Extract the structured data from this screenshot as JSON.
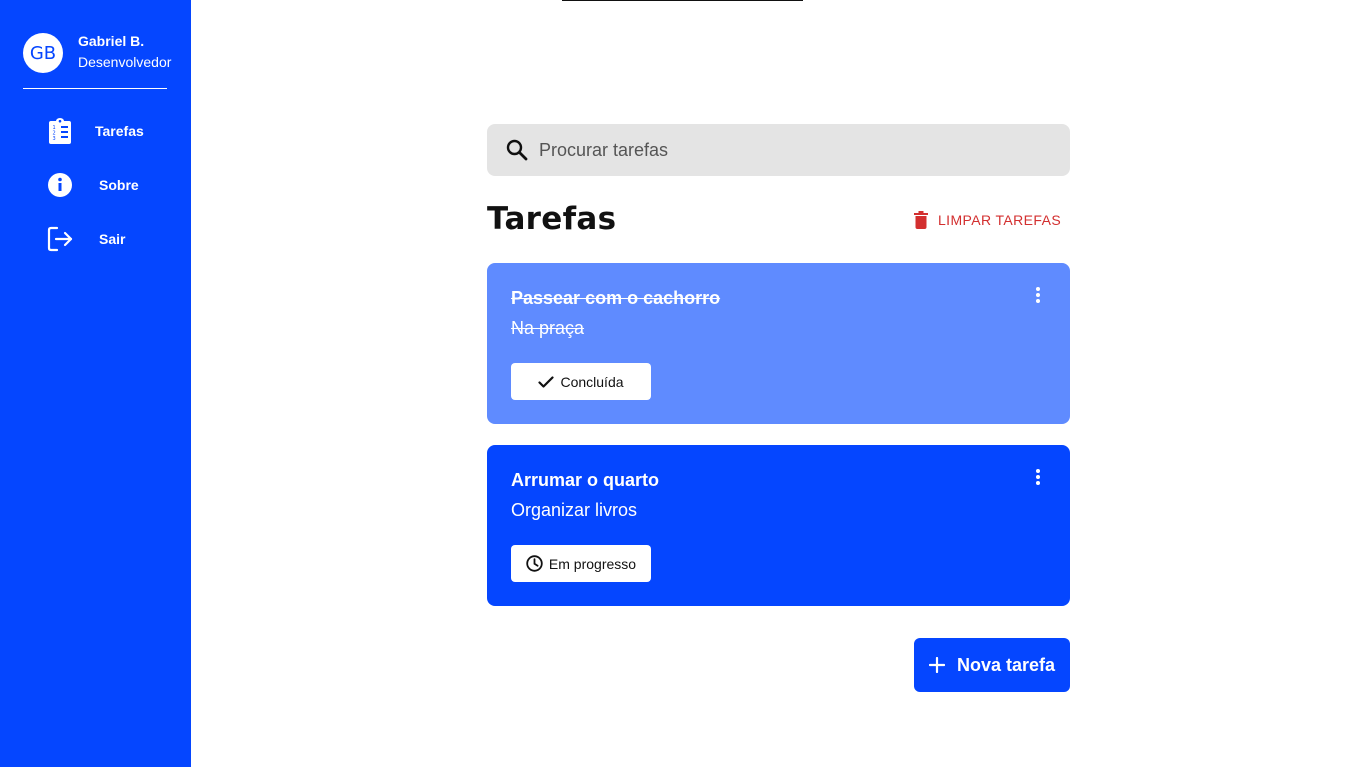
{
  "user": {
    "initials": "GB",
    "name": "Gabriel B.",
    "role": "Desenvolvedor"
  },
  "sidebar": {
    "items": [
      {
        "label": "Tarefas",
        "icon": "clipboard-list-icon"
      },
      {
        "label": "Sobre",
        "icon": "info-icon"
      },
      {
        "label": "Sair",
        "icon": "logout-icon"
      }
    ]
  },
  "search": {
    "placeholder": "Procurar tarefas",
    "value": ""
  },
  "main": {
    "title": "Tarefas",
    "clear_label": "LIMPAR TAREFAS"
  },
  "tasks": [
    {
      "title": "Passear com o cachorro",
      "description": "Na praça",
      "status": "Concluída",
      "status_icon": "check-icon",
      "completed": true
    },
    {
      "title": "Arrumar o quarto",
      "description": "Organizar livros",
      "status": "Em progresso",
      "status_icon": "clock-icon",
      "completed": false
    }
  ],
  "new_task_label": "Nova tarefa",
  "colors": {
    "primary": "#0546ff",
    "completed_card": "#5f8bff",
    "danger": "#d32f2f",
    "search_bg": "#e4e4e4"
  }
}
